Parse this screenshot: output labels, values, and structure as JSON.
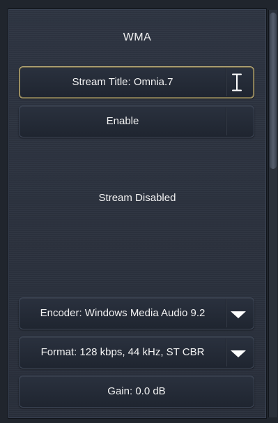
{
  "header": {
    "title": "WMA"
  },
  "stream_title_field": {
    "label": "Stream Title: Omnia.7",
    "icon": "text-cursor-icon"
  },
  "enable_button": {
    "label": "Enable"
  },
  "status": {
    "text": "Stream Disabled"
  },
  "encoder_select": {
    "label": "Encoder: Windows Media Audio 9.2",
    "icon": "dropdown-arrow-icon"
  },
  "format_select": {
    "label": "Format: 128 kbps, 44 kHz, ST CBR",
    "icon": "dropdown-arrow-icon"
  },
  "gain_button": {
    "label": "Gain: 0.0 dB"
  },
  "colors": {
    "background": "#2a303c",
    "text": "#f2f2f2",
    "selection_border": "#c2b27a"
  }
}
